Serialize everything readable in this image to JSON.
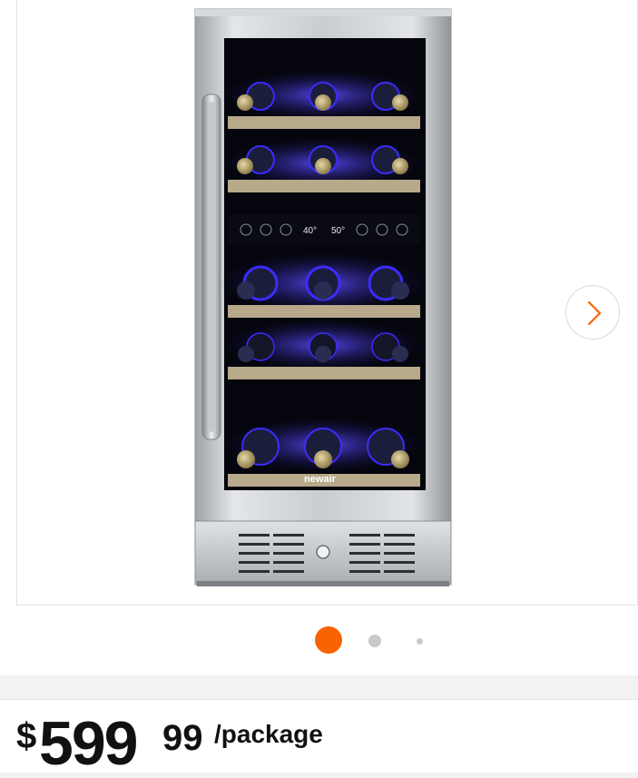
{
  "product": {
    "brand_logo": "newair",
    "display": {
      "left_temp": "40°",
      "right_temp": "50°"
    },
    "colors": {
      "accent": "#f96302",
      "led": "#3b2cff",
      "steel": "#c4c8cc"
    }
  },
  "gallery": {
    "next_icon": "chevron-right-icon",
    "dots": [
      {
        "state": "active"
      },
      {
        "state": "inactive"
      },
      {
        "state": "inactive"
      }
    ]
  },
  "price": {
    "currency": "$",
    "dollars": "599",
    "cents": "99",
    "unit": "/package"
  }
}
